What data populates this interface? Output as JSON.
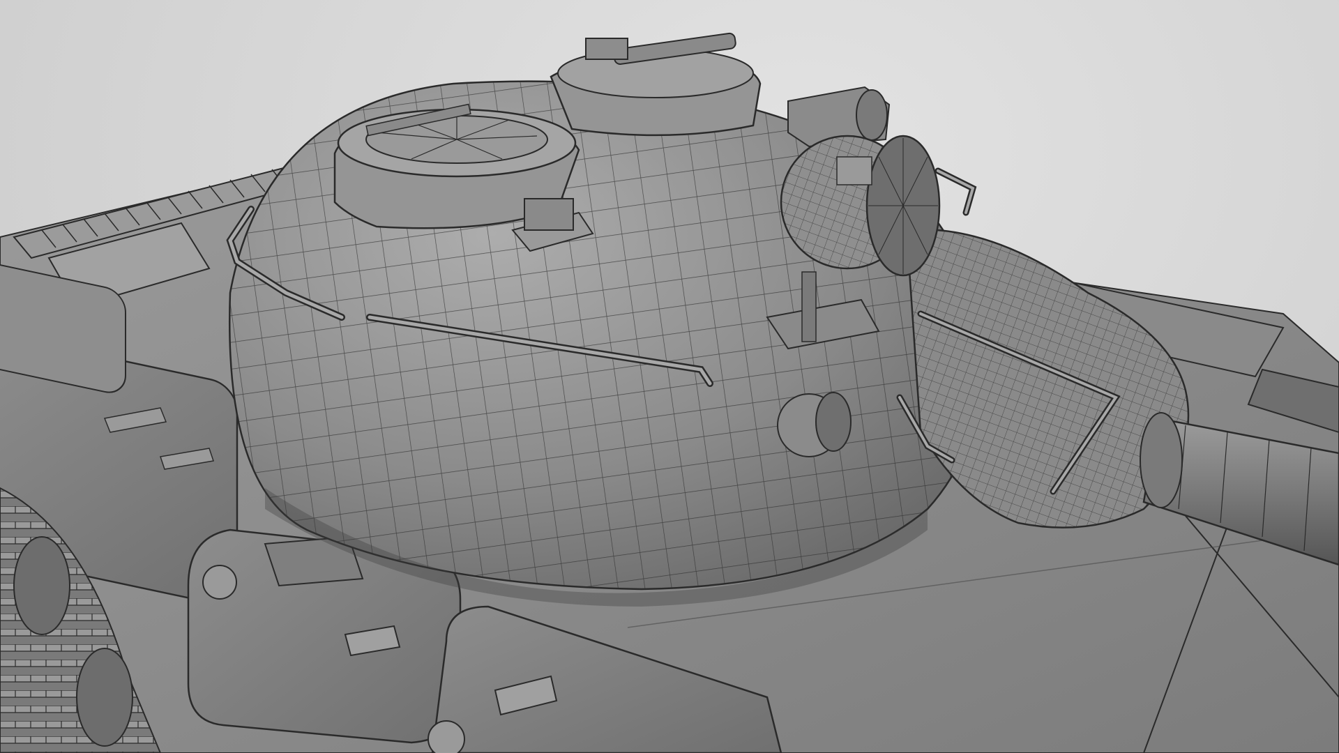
{
  "viewport": {
    "background_color": "#d6d6d6",
    "subject": "wireframe-3d-model-tank-turret",
    "colors": {
      "surface": "#8a8a8a",
      "surface_light": "#a8a8a8",
      "surface_dark": "#5e5e5e",
      "wire": "#2a2a2a"
    }
  }
}
